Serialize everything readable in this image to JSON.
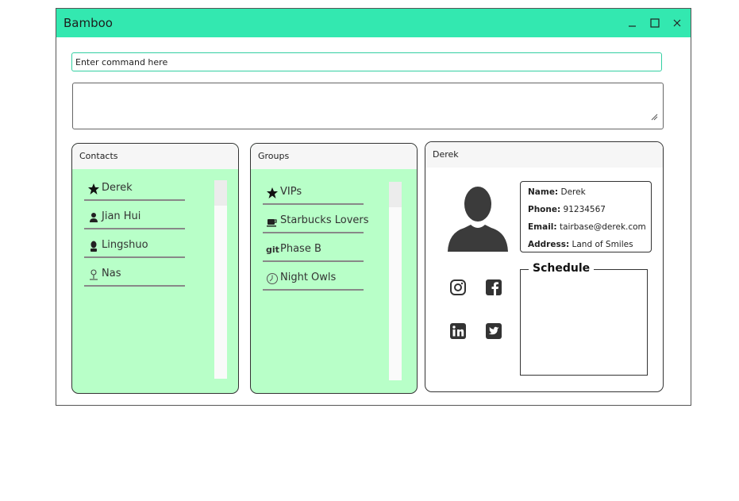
{
  "window": {
    "title": "Bamboo",
    "accent_color": "#33e8b0",
    "controls": [
      "minimize-icon",
      "maximize-icon",
      "close-icon"
    ]
  },
  "command": {
    "placeholder": "Enter command here",
    "value": ""
  },
  "result_display": {
    "value": ""
  },
  "contacts": {
    "header": "Contacts",
    "list_color": "#b8ffc8",
    "items": [
      {
        "label": "Derek",
        "icon": "star-icon"
      },
      {
        "label": "Jian Hui",
        "icon": "person-icon"
      },
      {
        "label": "Lingshuo",
        "icon": "bust-icon"
      },
      {
        "label": "Nas",
        "icon": "pin-person-icon"
      }
    ]
  },
  "groups": {
    "header": "Groups",
    "items": [
      {
        "label": "VIPs",
        "icon": "star-icon"
      },
      {
        "label": "Starbucks Lovers",
        "icon": "coffee-icon"
      },
      {
        "label": "Phase B",
        "icon": "git-icon",
        "icon_text": "git"
      },
      {
        "label": "Night Owls",
        "icon": "clock-icon"
      }
    ]
  },
  "detail": {
    "header": "Derek",
    "name_label": "Name:",
    "name": "Derek",
    "phone_label": "Phone:",
    "phone": "91234567",
    "email_label": "Email:",
    "email": "tairbase@derek.com",
    "address_label": "Address:",
    "address": "Land of Smiles",
    "schedule_title": "Schedule",
    "socials": [
      "instagram-icon",
      "facebook-icon",
      "linkedin-icon",
      "twitter-icon"
    ]
  }
}
